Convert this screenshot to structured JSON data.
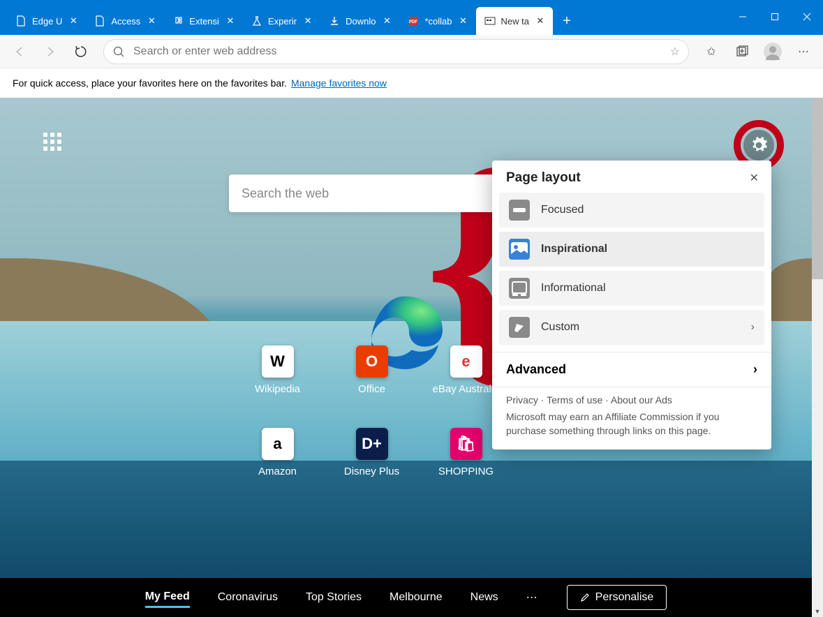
{
  "tabs": [
    {
      "label": "Edge U",
      "icon": "page"
    },
    {
      "label": "Access",
      "icon": "page"
    },
    {
      "label": "Extensi",
      "icon": "puzzle"
    },
    {
      "label": "Experir",
      "icon": "flask"
    },
    {
      "label": "Downlo",
      "icon": "download"
    },
    {
      "label": "*collab",
      "icon": "pdf"
    },
    {
      "label": "New ta",
      "icon": "ntp",
      "active": true
    }
  ],
  "toolbar": {
    "address_placeholder": "Search or enter web address"
  },
  "favbar": {
    "text": "For quick access, place your favorites here on the favorites bar.",
    "link": "Manage favorites now"
  },
  "ntp": {
    "search_placeholder": "Search the web",
    "tiles": [
      {
        "label": "Wikipedia",
        "icon": "W",
        "bg": "#fff",
        "fg": "#000"
      },
      {
        "label": "Office",
        "icon": "O",
        "bg": "#eb3c00",
        "fg": "#fff"
      },
      {
        "label": "eBay Australia",
        "icon": "e",
        "bg": "#fff",
        "fg": "#e53238"
      },
      {
        "label": "Amazon",
        "icon": "a",
        "bg": "#fff",
        "fg": "#000"
      },
      {
        "label": "Disney Plus",
        "icon": "D+",
        "bg": "#0b1e4b",
        "fg": "#fff"
      },
      {
        "label": "SHOPPING",
        "icon": "🛍",
        "bg": "#e2006a",
        "fg": "#fff"
      }
    ]
  },
  "panel": {
    "title": "Page layout",
    "options": [
      {
        "label": "Focused",
        "icon_bg": "#8a8a8a"
      },
      {
        "label": "Inspirational",
        "icon_bg": "#3b82d6",
        "selected": true
      },
      {
        "label": "Informational",
        "icon_bg": "#8a8a8a"
      },
      {
        "label": "Custom",
        "icon_bg": "#8a8a8a",
        "chevron": true
      }
    ],
    "advanced": "Advanced",
    "links": [
      "Privacy",
      "Terms of use",
      "About our Ads"
    ],
    "note": "Microsoft may earn an Affiliate Commission if you purchase something through links on this page."
  },
  "feed": {
    "items": [
      "My Feed",
      "Coronavirus",
      "Top Stories",
      "Melbourne",
      "News"
    ],
    "active": 0,
    "personalise": "Personalise"
  }
}
